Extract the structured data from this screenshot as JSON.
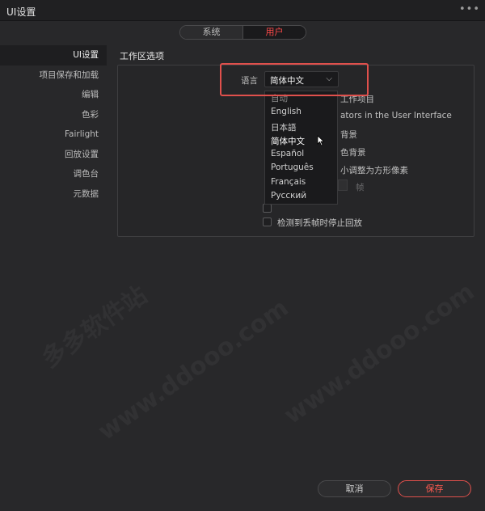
{
  "window": {
    "title": "UI设置",
    "more_icon": "more-icon"
  },
  "tabs": [
    {
      "label": "系统",
      "active": false
    },
    {
      "label": "用户",
      "active": true
    }
  ],
  "sidebar": {
    "items": [
      {
        "label": "UI设置",
        "active": true
      },
      {
        "label": "项目保存和加载",
        "active": false
      },
      {
        "label": "编辑",
        "active": false
      },
      {
        "label": "色彩",
        "active": false
      },
      {
        "label": "Fairlight",
        "active": false
      },
      {
        "label": "回放设置",
        "active": false
      },
      {
        "label": "调色台",
        "active": false
      },
      {
        "label": "元数据",
        "active": false
      }
    ]
  },
  "section_title": "工作区选项",
  "language": {
    "label": "语言",
    "selected": "简体中文",
    "options": [
      "自动",
      "English",
      "日本語",
      "简体中文",
      "Español",
      "Português",
      "Français",
      "Русский"
    ]
  },
  "options_partial": [
    "工作项目",
    "ators in the User Interface",
    "背景",
    "色背景",
    "小调整为方形像素"
  ],
  "frame_label": "帧",
  "option_stop_playback": "检测到丢帧时停止回放",
  "buttons": {
    "cancel": "取消",
    "save": "保存"
  },
  "watermark": [
    "多多软件站",
    "www.ddooo.com"
  ],
  "colors": {
    "accent": "#ff4a4a",
    "highlight": "#e0504c"
  }
}
